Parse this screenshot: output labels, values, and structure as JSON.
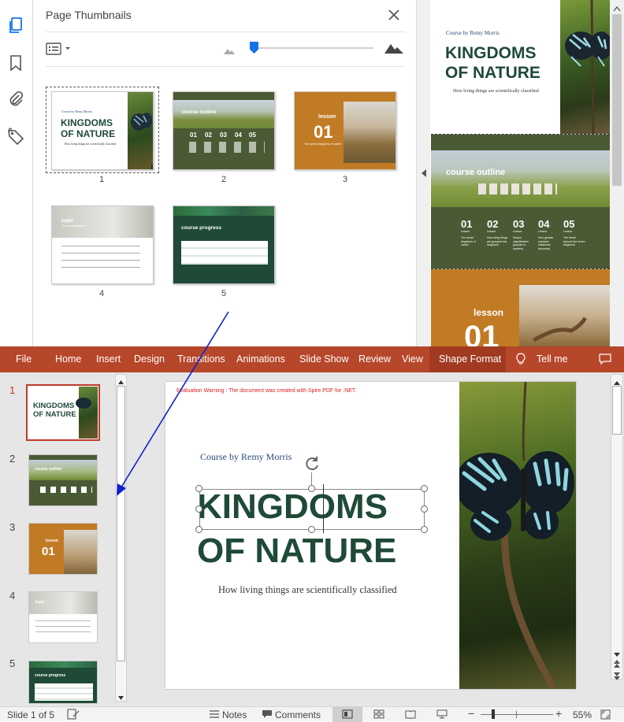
{
  "pdf": {
    "panel_title": "Page Thumbnails",
    "pages": [
      {
        "num": "1",
        "author": "Course by Remy Morris",
        "title1": "KINGDOMS",
        "title2": "OF NATURE",
        "subtitle": "How living things are scientifically classified"
      },
      {
        "num": "2",
        "heading": "course outline",
        "items": [
          "01",
          "02",
          "03",
          "04",
          "05"
        ]
      },
      {
        "num": "3",
        "label": "lesson",
        "number": "01",
        "caption": "The seven kingdoms of nature"
      },
      {
        "num": "4",
        "label": "topic",
        "caption": "The animal kingdom"
      },
      {
        "num": "5",
        "heading": "course progress"
      }
    ],
    "preview": {
      "author": "Course by Remy Morris",
      "title1": "KINGDOMS",
      "title2": "OF NATURE",
      "subtitle": "How living things are scientifically classified",
      "outline_heading": "course outline",
      "outline_numbers": [
        "01",
        "02",
        "03",
        "04",
        "05"
      ],
      "outline_words": [
        "Lesson",
        "Lesson",
        "Lesson",
        "Lesson",
        "Lesson"
      ],
      "outline_desc": [
        "The seven kingdoms of nature",
        "How living things are grouped into kingdoms",
        "Deeper classification (phylum to species)",
        "How genetic research influences taxonomy",
        "The future beyond the seven kingdoms"
      ],
      "lesson_label": "lesson",
      "lesson_number": "01"
    }
  },
  "ppt": {
    "tabs": [
      "File",
      "Home",
      "Insert",
      "Design",
      "Transitions",
      "Animations",
      "Slide Show",
      "Review",
      "View",
      "Shape Format",
      "Tell me"
    ],
    "slide_numbers": [
      "1",
      "2",
      "3",
      "4",
      "5"
    ],
    "thumb2_title": "course outline",
    "thumb3_label": "lesson",
    "thumb3_number": "01",
    "thumb4_label": "topic",
    "thumb5_title": "course progress",
    "slide": {
      "warning": "Evaluation Warning : The document was created with Spire.PDF for .NET.",
      "author": "Course by Remy Morris",
      "title1": "KINGDOMS",
      "title2": "OF NATURE",
      "subtitle": "How living things are scientifically classified"
    },
    "status": {
      "slide_info": "Slide 1 of 5",
      "notes": "Notes",
      "comments": "Comments",
      "zoom": "55%",
      "zoom_minus": "−",
      "zoom_plus": "+"
    }
  },
  "colors": {
    "ribbon": "#b7472a",
    "green_dark": "#1f4a37",
    "olive": "#4a5a34",
    "ochre": "#c27b25",
    "accent_blue": "#1473e6"
  }
}
